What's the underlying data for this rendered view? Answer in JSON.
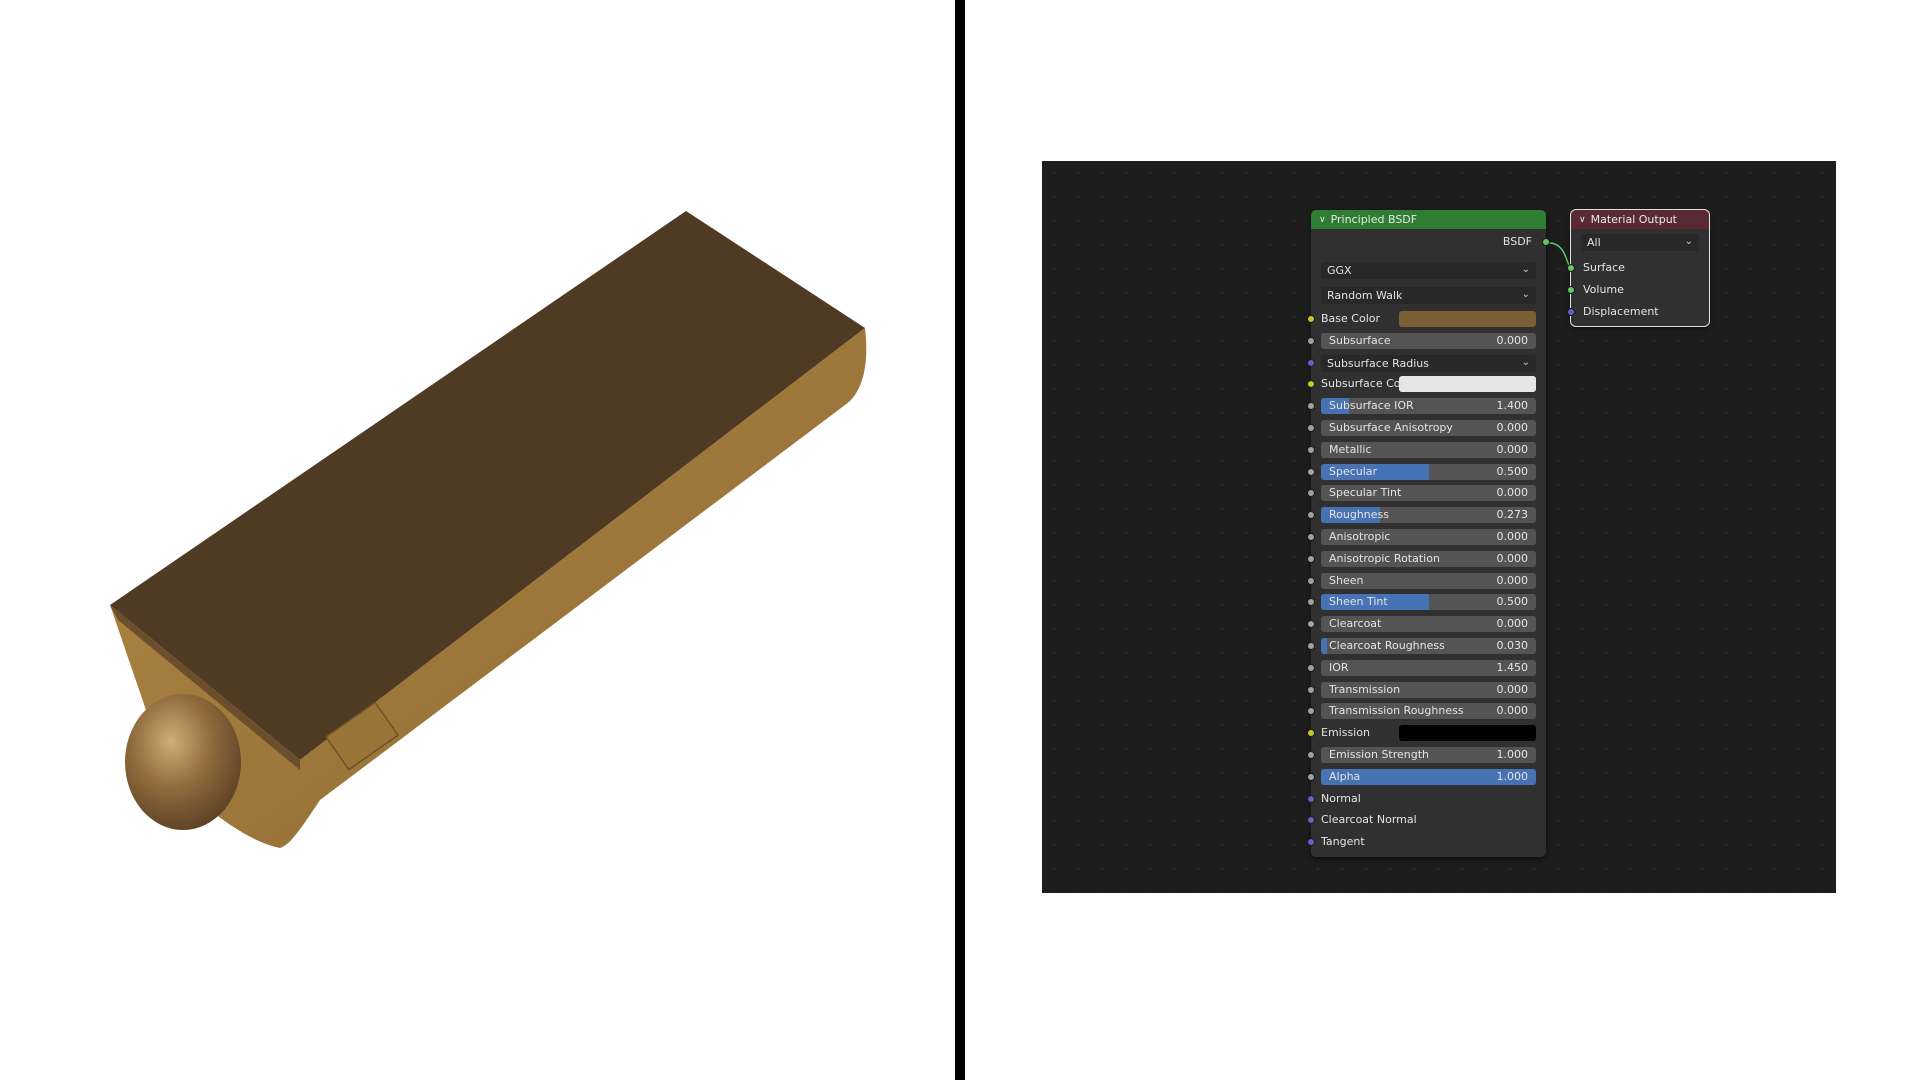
{
  "colors": {
    "editor_bg": "#1d1d1d",
    "node_bg": "#303030",
    "bsdf_header": "#2e7d32",
    "output_header": "#5a2a34",
    "slider_fill": "#4772b3",
    "socket_yellow": "#c7c729",
    "socket_grey": "#a1a1a1",
    "socket_purple": "#6363c7",
    "socket_green": "#63c763",
    "base_color": "#7a5f36",
    "subsurface_color": "#e6e6e6",
    "emission_color": "#000000",
    "object_top": "#4f3b24",
    "object_side": "#a8803f"
  },
  "principled": {
    "title": "Principled BSDF",
    "output_label": "BSDF",
    "distribution": "GGX",
    "subsurface_method": "Random Walk",
    "inputs": [
      {
        "kind": "color",
        "label": "Base Color",
        "socket": "yellow",
        "color": "#7a5f36"
      },
      {
        "kind": "slider",
        "label": "Subsurface",
        "value": "0.000",
        "fraction": 0,
        "socket": "grey"
      },
      {
        "kind": "dropdown",
        "label": "Subsurface Radius",
        "socket": "purple"
      },
      {
        "kind": "color",
        "label": "Subsurface Co...",
        "socket": "yellow",
        "color": "#e6e6e6"
      },
      {
        "kind": "slider",
        "label": "Subsurface IOR",
        "value": "1.400",
        "fraction": 0.13,
        "socket": "grey"
      },
      {
        "kind": "slider",
        "label": "Subsurface Anisotropy",
        "value": "0.000",
        "fraction": 0,
        "socket": "grey"
      },
      {
        "kind": "slider",
        "label": "Metallic",
        "value": "0.000",
        "fraction": 0,
        "socket": "grey"
      },
      {
        "kind": "slider",
        "label": "Specular",
        "value": "0.500",
        "fraction": 0.5,
        "socket": "grey"
      },
      {
        "kind": "slider",
        "label": "Specular Tint",
        "value": "0.000",
        "fraction": 0,
        "socket": "grey"
      },
      {
        "kind": "slider",
        "label": "Roughness",
        "value": "0.273",
        "fraction": 0.273,
        "socket": "grey"
      },
      {
        "kind": "slider",
        "label": "Anisotropic",
        "value": "0.000",
        "fraction": 0,
        "socket": "grey"
      },
      {
        "kind": "slider",
        "label": "Anisotropic Rotation",
        "value": "0.000",
        "fraction": 0,
        "socket": "grey"
      },
      {
        "kind": "slider",
        "label": "Sheen",
        "value": "0.000",
        "fraction": 0,
        "socket": "grey"
      },
      {
        "kind": "slider",
        "label": "Sheen Tint",
        "value": "0.500",
        "fraction": 0.5,
        "socket": "grey"
      },
      {
        "kind": "slider",
        "label": "Clearcoat",
        "value": "0.000",
        "fraction": 0,
        "socket": "grey"
      },
      {
        "kind": "slider",
        "label": "Clearcoat Roughness",
        "value": "0.030",
        "fraction": 0.03,
        "socket": "grey"
      },
      {
        "kind": "slider",
        "label": "IOR",
        "value": "1.450",
        "fraction": 0,
        "socket": "grey"
      },
      {
        "kind": "slider",
        "label": "Transmission",
        "value": "0.000",
        "fraction": 0,
        "socket": "grey"
      },
      {
        "kind": "slider",
        "label": "Transmission Roughness",
        "value": "0.000",
        "fraction": 0,
        "socket": "grey"
      },
      {
        "kind": "color",
        "label": "Emission",
        "socket": "yellow",
        "color": "#000000"
      },
      {
        "kind": "slider",
        "label": "Emission Strength",
        "value": "1.000",
        "fraction": 0,
        "socket": "grey"
      },
      {
        "kind": "slider",
        "label": "Alpha",
        "value": "1.000",
        "fraction": 1,
        "socket": "grey"
      },
      {
        "kind": "label",
        "label": "Normal",
        "socket": "purple"
      },
      {
        "kind": "label",
        "label": "Clearcoat Normal",
        "socket": "purple"
      },
      {
        "kind": "label",
        "label": "Tangent",
        "socket": "purple"
      }
    ]
  },
  "material_output": {
    "title": "Material Output",
    "target": "All",
    "inputs": [
      {
        "label": "Surface",
        "socket": "green"
      },
      {
        "label": "Volume",
        "socket": "green"
      },
      {
        "label": "Displacement",
        "socket": "purple"
      }
    ]
  }
}
